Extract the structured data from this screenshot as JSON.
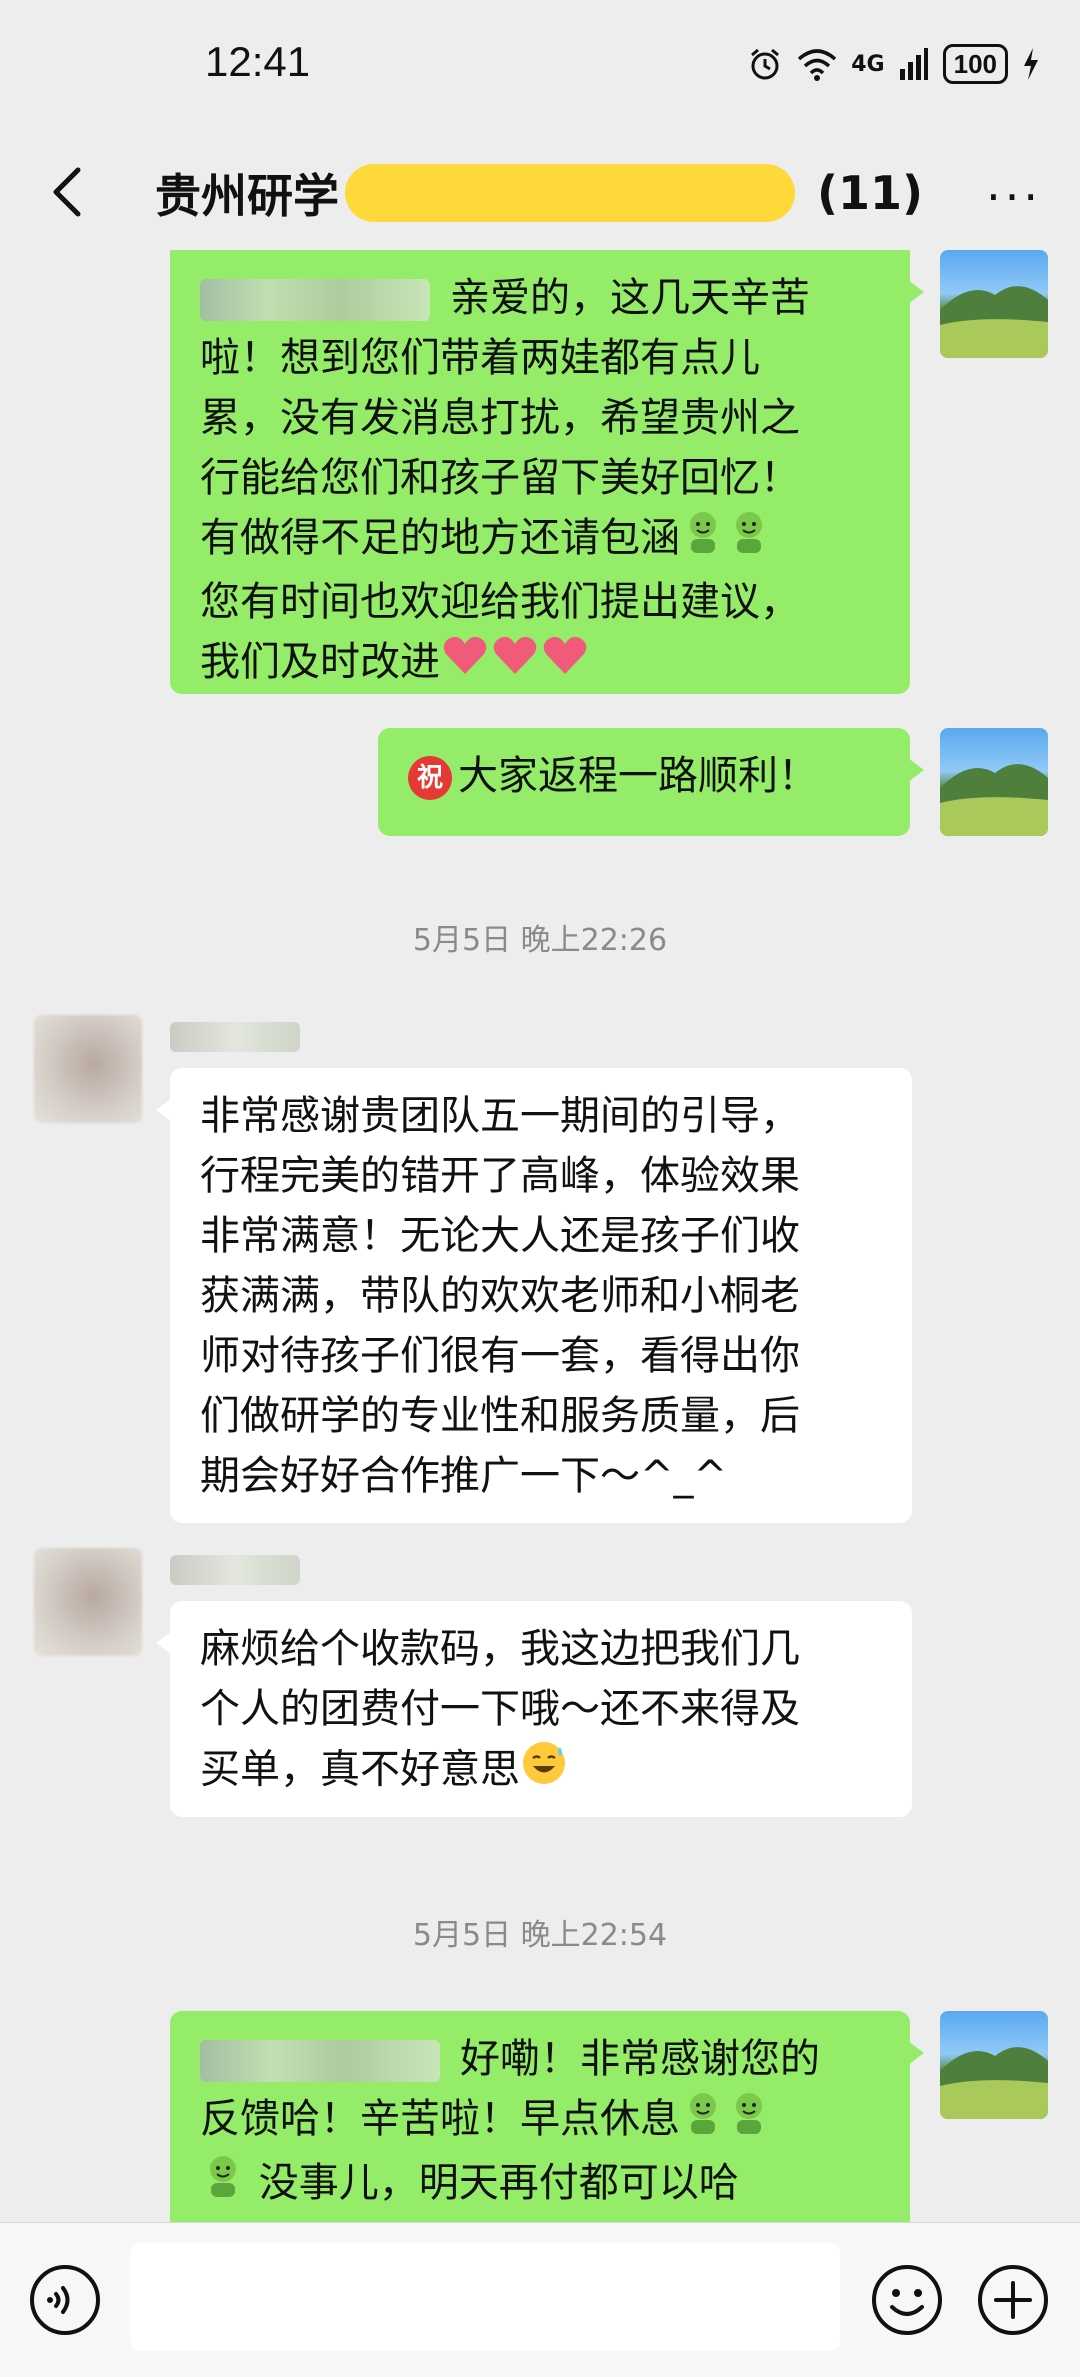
{
  "status_bar": {
    "time": "12:41",
    "network": "4G",
    "battery": "100"
  },
  "header": {
    "title": "贵州研学",
    "count": "(11)",
    "more_label": "···"
  },
  "messages": [
    {
      "direction": "out",
      "lines": [
        "亲爱的，这几天辛苦",
        "啦！想到您们带着两娃都有点儿",
        "累，没有发消息打扰，希望贵州之",
        "行能给您们和孩子留下美好回忆！",
        "有做得不足的地方还请包涵",
        "您有时间也欢迎给我们提出建议，",
        "我们及时改进"
      ]
    },
    {
      "direction": "out",
      "wish_icon": "祝",
      "text": "大家返程一路顺利！"
    },
    {
      "timestamp": "5月5日 晚上22:26"
    },
    {
      "direction": "in",
      "lines": [
        "非常感谢贵团队五一期间的引导，",
        "行程完美的错开了高峰，体验效果",
        "非常满意！无论大人还是孩子们收",
        "获满满，带队的欢欢老师和小桐老",
        "师对待孩子们很有一套，看得出你",
        "们做研学的专业性和服务质量，后",
        "期会好好合作推广一下～^_^"
      ]
    },
    {
      "direction": "in",
      "lines": [
        "麻烦给个收款码，我这边把我们几",
        "个人的团费付一下哦～还不来得及",
        "买单，真不好意思"
      ]
    },
    {
      "timestamp": "5月5日 晚上22:54"
    },
    {
      "direction": "out",
      "lines": [
        "好嘞！非常感谢您的",
        "反馈哈！辛苦啦！早点休息",
        "没事儿，明天再付都可以哈"
      ]
    }
  ],
  "input": {
    "value": "",
    "placeholder": ""
  },
  "colors": {
    "outgoing_bubble": "#95ec69",
    "incoming_bubble": "#ffffff",
    "background": "#ededed",
    "redaction": "#ffd83a"
  }
}
